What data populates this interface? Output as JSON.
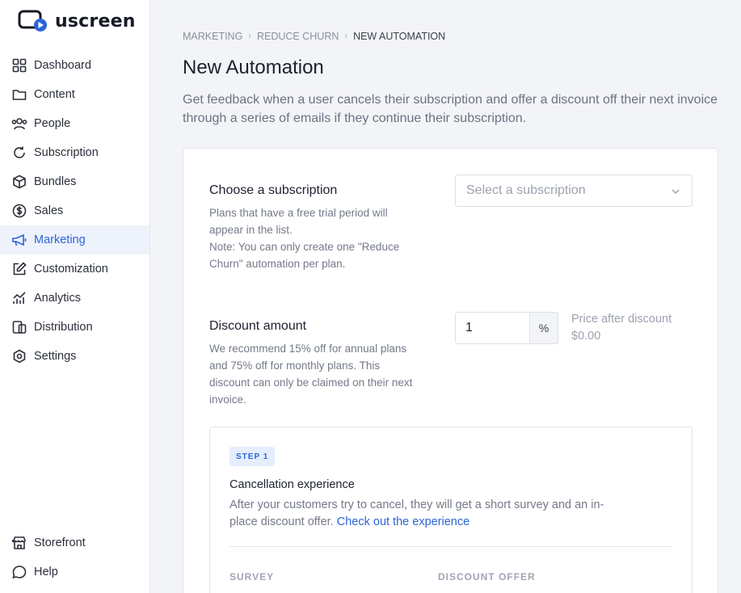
{
  "brand": {
    "name": "uscreen",
    "accent": "#2a65d8"
  },
  "sidebar": {
    "items": [
      {
        "label": "Dashboard",
        "icon": "grid-icon"
      },
      {
        "label": "Content",
        "icon": "folder-icon"
      },
      {
        "label": "People",
        "icon": "people-icon"
      },
      {
        "label": "Subscription",
        "icon": "refresh-icon"
      },
      {
        "label": "Bundles",
        "icon": "box-icon"
      },
      {
        "label": "Sales",
        "icon": "dollar-icon"
      },
      {
        "label": "Marketing",
        "icon": "megaphone-icon",
        "active": true
      },
      {
        "label": "Customization",
        "icon": "edit-icon"
      },
      {
        "label": "Analytics",
        "icon": "analytics-icon"
      },
      {
        "label": "Distribution",
        "icon": "devices-icon"
      },
      {
        "label": "Settings",
        "icon": "gear-icon"
      }
    ],
    "bottom": [
      {
        "label": "Storefront",
        "icon": "storefront-icon"
      },
      {
        "label": "Help",
        "icon": "chat-icon"
      }
    ]
  },
  "breadcrumb": [
    "MARKETING",
    "REDUCE CHURN",
    "NEW AUTOMATION"
  ],
  "page": {
    "title": "New Automation",
    "description": "Get feedback when a user cancels their subscription and offer a discount off their next invoice through a series of emails if they continue their subscription."
  },
  "subscription": {
    "title": "Choose a subscription",
    "help": "Plans that have a free trial period will appear in the list.\nNote: You can only create one \"Reduce Churn\" automation per plan.",
    "placeholder": "Select a subscription"
  },
  "discount": {
    "title": "Discount amount",
    "help": "We recommend 15% off for annual plans and 75% off for monthly plans. This discount can only be claimed on their next invoice.",
    "value": "1",
    "unit": "%",
    "price_label": "Price after discount",
    "price_value": "$0.00"
  },
  "step": {
    "badge": "STEP 1",
    "title": "Cancellation experience",
    "description": "After your customers try to cancel, they will get a short survey and an in-place discount offer. ",
    "link": "Check out the experience",
    "columns": [
      "SURVEY",
      "DISCOUNT OFFER"
    ]
  }
}
